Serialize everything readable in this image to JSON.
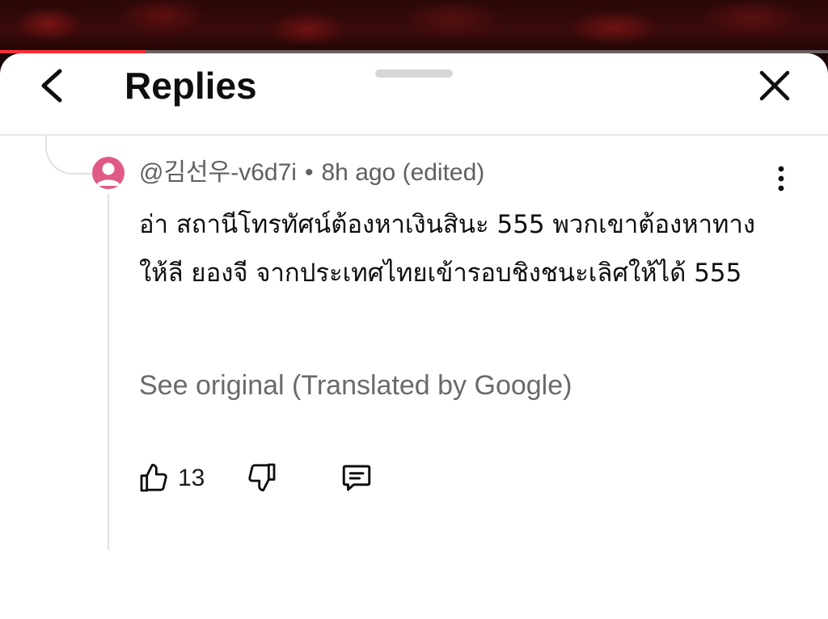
{
  "video": {
    "progress_fraction": 0.176,
    "progress_color": "#ff2d3a"
  },
  "header": {
    "title": "Replies",
    "back_icon": "chevron-left-icon",
    "close_icon": "close-icon"
  },
  "comment": {
    "author": "@김선우-v6d7i",
    "separator": "•",
    "time": "8h ago (edited)",
    "text": "อ่า สถานีโทรทัศน์ต้องหาเงินสินะ 555 พวกเขาต้องหาทางให้ลี ยองจี จากประเทศไทยเข้ารอบชิงชนะเลิศให้ได้ 555",
    "translate_label": "See original (Translated by Google)",
    "like_count": "13",
    "avatar_color": "#e05a86"
  }
}
